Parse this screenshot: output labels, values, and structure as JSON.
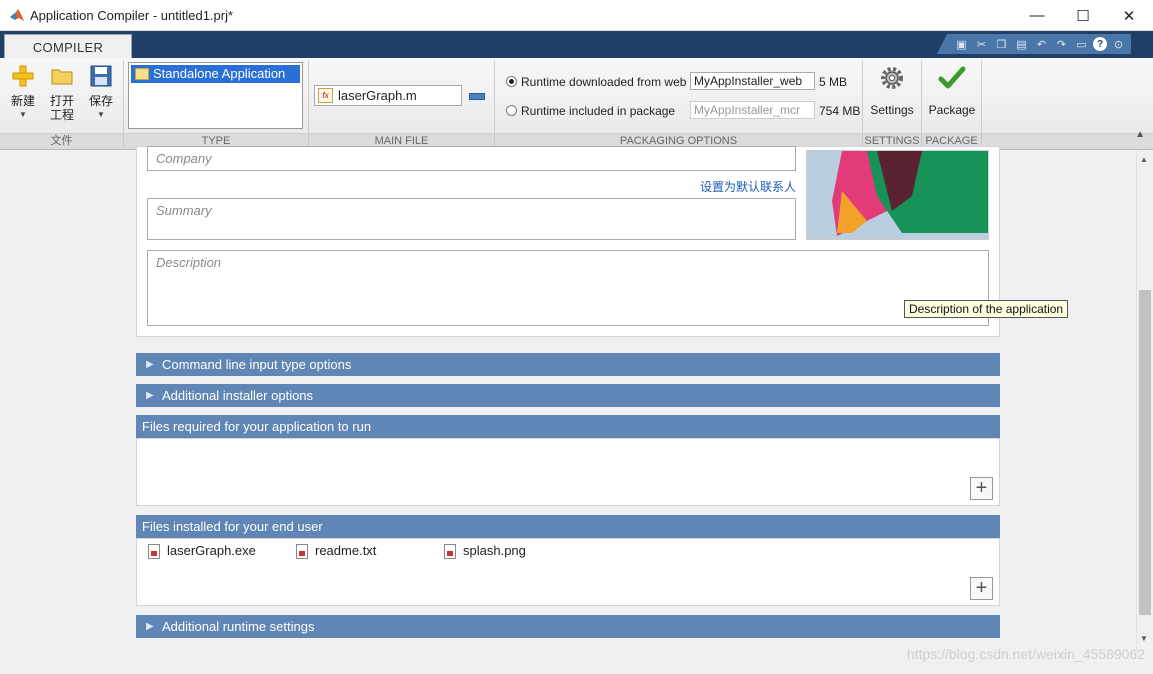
{
  "window": {
    "title": "Application Compiler - untitled1.prj*",
    "minimize_glyph": "—",
    "maximize_glyph": "☐",
    "close_glyph": "✕"
  },
  "ribbon": {
    "tab": "COMPILER",
    "file_section": {
      "new_label": "新建",
      "open_label_line1": "打开",
      "open_label_line2": "工程",
      "save_label": "保存",
      "section_label": "文件"
    },
    "type_section": {
      "selected_type": "Standalone Application",
      "section_label": "TYPE"
    },
    "main_file_section": {
      "main_file": "laserGraph.m",
      "section_label": "MAIN FILE"
    },
    "packaging_section": {
      "option_web_label": "Runtime downloaded from web",
      "option_web_value": "MyAppInstaller_web",
      "option_web_size": "5 MB",
      "option_pkg_label": "Runtime included in package",
      "option_pkg_value": "MyAppInstaller_mcr",
      "option_pkg_size": "754 MB",
      "selected": "web",
      "section_label": "PACKAGING OPTIONS"
    },
    "settings_section": {
      "settings_label": "Settings",
      "section_label": "SETTINGS"
    },
    "package_section": {
      "package_label": "Package",
      "section_label": "PACKAGE"
    }
  },
  "app_info": {
    "company_placeholder": "Company",
    "set_default_contact_link": "设置为默认联系人",
    "summary_placeholder": "Summary",
    "description_placeholder": "Description",
    "description_tooltip": "Description of the application"
  },
  "sections": {
    "command_line": "Command line input type options",
    "additional_installer": "Additional installer options",
    "files_required": "Files required for your application to run",
    "files_installed": "Files installed for your end user",
    "additional_runtime": "Additional runtime settings"
  },
  "installed_files": [
    "laserGraph.exe",
    "readme.txt",
    "splash.png"
  ],
  "watermark": "https://blog.csdn.net/weixin_45589062",
  "colors": {
    "ribbon_dark": "#1f3e68",
    "section_bar": "#5f86b4",
    "selection": "#2a6fd6",
    "link": "#1e5bb6"
  }
}
